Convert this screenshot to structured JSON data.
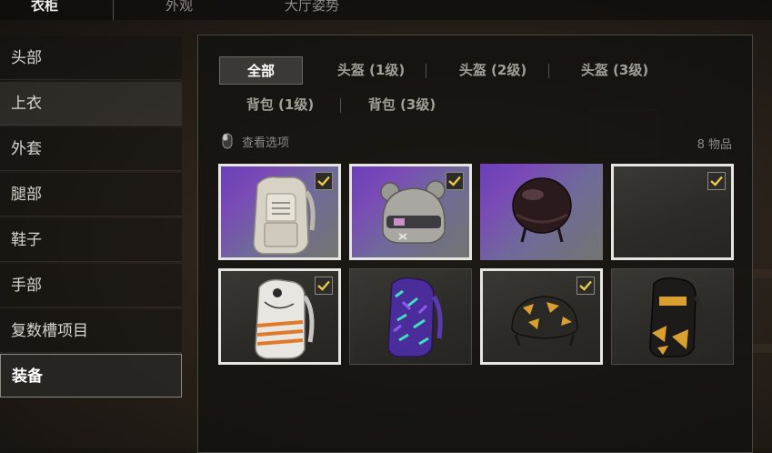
{
  "top_tabs": [
    {
      "label": "衣柜",
      "active": true
    },
    {
      "label": "外观",
      "active": false
    },
    {
      "label": "大厅姿势",
      "active": false
    }
  ],
  "sidebar": {
    "items": [
      {
        "label": "头部",
        "state": "normal"
      },
      {
        "label": "上衣",
        "state": "hover"
      },
      {
        "label": "外套",
        "state": "normal"
      },
      {
        "label": "腿部",
        "state": "normal"
      },
      {
        "label": "鞋子",
        "state": "normal"
      },
      {
        "label": "手部",
        "state": "normal"
      },
      {
        "label": "复数槽项目",
        "state": "normal"
      },
      {
        "label": "装备",
        "state": "active"
      }
    ]
  },
  "filters": {
    "row1": [
      "全部",
      "头盔 (1级)",
      "头盔 (2级)",
      "头盔 (3级)"
    ],
    "row2": [
      "背包 (1级)",
      "背包 (3级)"
    ],
    "active": "全部"
  },
  "view_options": {
    "label": "查看选项",
    "icon": "mouse-icon"
  },
  "item_count": "8 物品",
  "items": [
    {
      "name": "backpack-white",
      "background": "purple",
      "selected": true,
      "checked": true
    },
    {
      "name": "helmet-bear-ears",
      "background": "purple",
      "selected": true,
      "checked": true
    },
    {
      "name": "helmet-black-gloss",
      "background": "purple",
      "selected": false,
      "checked": false
    },
    {
      "name": "empty-slot",
      "background": "dark",
      "selected": true,
      "checked": true
    },
    {
      "name": "backpack-white-orange",
      "background": "dark",
      "selected": true,
      "checked": true
    },
    {
      "name": "backpack-purple-teal",
      "background": "dark",
      "selected": false,
      "checked": false
    },
    {
      "name": "helmet-black-gold",
      "background": "dark",
      "selected": true,
      "checked": true
    },
    {
      "name": "backpack-black-gold",
      "background": "dark",
      "selected": false,
      "checked": false
    }
  ],
  "colors": {
    "check": "#e8c94a",
    "accent_border": "#e7e5df"
  }
}
